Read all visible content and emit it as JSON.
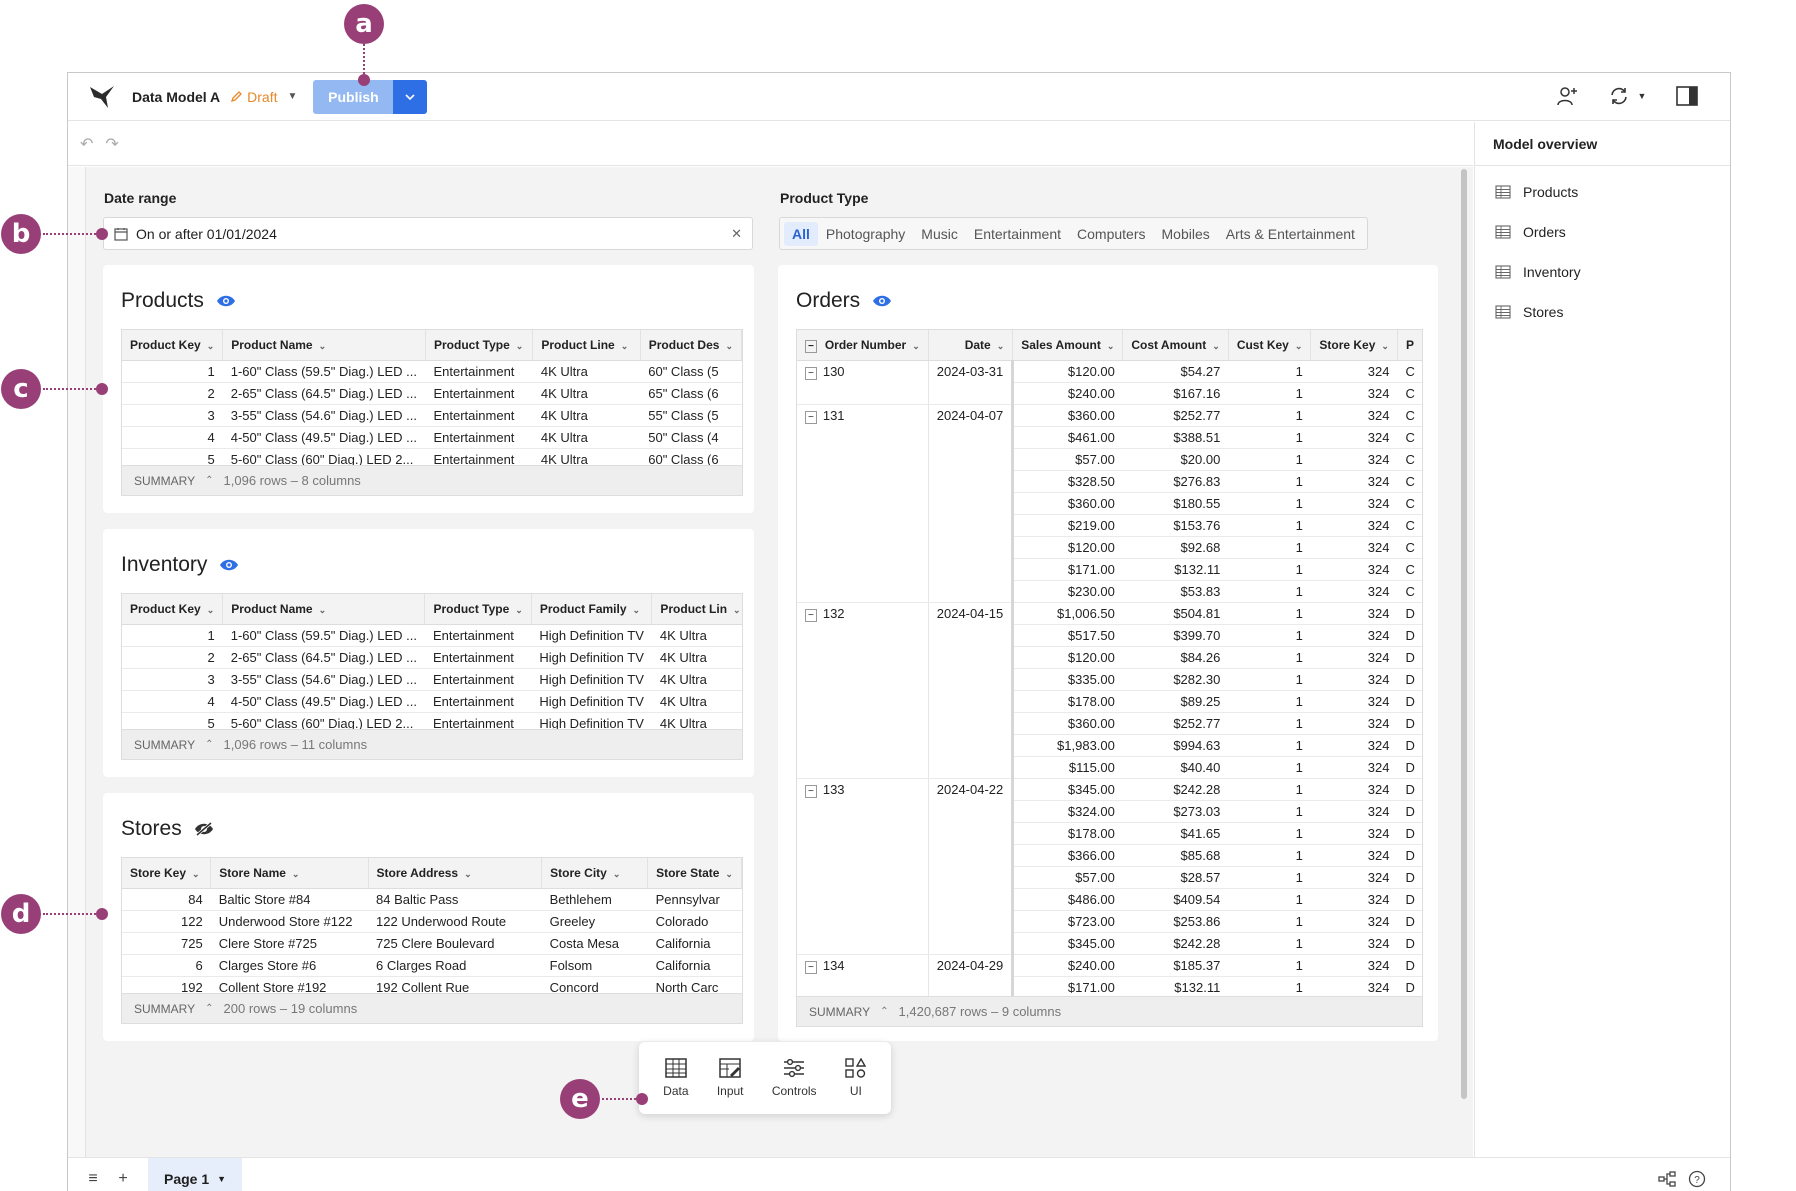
{
  "header": {
    "model_title": "Data Model A",
    "draft_label": "Draft",
    "publish_label": "Publish"
  },
  "filters": {
    "date_label": "Date range",
    "date_value": "On or after 01/01/2024",
    "ptype_label": "Product Type",
    "ptype_options": [
      "All",
      "Photography",
      "Music",
      "Entertainment",
      "Computers",
      "Mobiles",
      "Arts & Entertainment"
    ]
  },
  "products": {
    "title": "Products",
    "columns": [
      "Product Key",
      "Product Name",
      "Product Type",
      "Product Line",
      "Product Des"
    ],
    "rows": [
      [
        "1",
        "1-60\" Class (59.5\" Diag.)  LED  ...",
        "Entertainment",
        "4K Ultra",
        "60\" Class (5"
      ],
      [
        "2",
        "2-65\" Class (64.5\" Diag.)  LED  ...",
        "Entertainment",
        "4K Ultra",
        "65\" Class (6"
      ],
      [
        "3",
        "3-55\" Class (54.6\" Diag.)  LED  ...",
        "Entertainment",
        "4K Ultra",
        "55\" Class (5"
      ],
      [
        "4",
        "4-50\" Class (49.5\" Diag.)  LED  ...",
        "Entertainment",
        "4K Ultra",
        "50\" Class (4"
      ],
      [
        "5",
        "5-60\" Class (60\" Diag.)  LED  2...",
        "Entertainment",
        "4K Ultra",
        "60\" Class (6"
      ]
    ],
    "summary_label": "SUMMARY",
    "summary_text": "1,096 rows – 8 columns"
  },
  "inventory": {
    "title": "Inventory",
    "columns": [
      "Product Key",
      "Product Name",
      "Product Type",
      "Product Family",
      "Product Lin"
    ],
    "rows": [
      [
        "1",
        "1-60\" Class (59.5\" Diag.)  LED  ...",
        "Entertainment",
        "High Definition TV",
        "4K Ultra"
      ],
      [
        "2",
        "2-65\" Class (64.5\" Diag.)  LED  ...",
        "Entertainment",
        "High Definition TV",
        "4K Ultra"
      ],
      [
        "3",
        "3-55\" Class (54.6\" Diag.)  LED  ...",
        "Entertainment",
        "High Definition TV",
        "4K Ultra"
      ],
      [
        "4",
        "4-50\" Class (49.5\" Diag.)  LED  ...",
        "Entertainment",
        "High Definition TV",
        "4K Ultra"
      ],
      [
        "5",
        "5-60\" Class (60\" Diag.)  LED  2...",
        "Entertainment",
        "High Definition TV",
        "4K Ultra"
      ]
    ],
    "summary_label": "SUMMARY",
    "summary_text": "1,096 rows – 11 columns"
  },
  "stores": {
    "title": "Stores",
    "columns": [
      "Store Key",
      "Store Name",
      "Store Address",
      "Store City",
      "Store State"
    ],
    "rows": [
      [
        "84",
        "Baltic Store #84",
        "84 Baltic Pass",
        "Bethlehem",
        "Pennsylvar"
      ],
      [
        "122",
        "Underwood Store #122",
        "122 Underwood Route",
        "Greeley",
        "Colorado"
      ],
      [
        "725",
        "Clere Store #725",
        "725 Clere Boulevard",
        "Costa Mesa",
        "California"
      ],
      [
        "6",
        "Clarges Store #6",
        "6 Clarges Road",
        "Folsom",
        "California"
      ],
      [
        "192",
        "Collent Store #192",
        "192 Collent Rue",
        "Concord",
        "North Carc"
      ]
    ],
    "summary_label": "SUMMARY",
    "summary_text": "200 rows – 19 columns"
  },
  "orders": {
    "title": "Orders",
    "columns": [
      "Order Number",
      "Date",
      "Sales Amount",
      "Cost Amount",
      "Cust Key",
      "Store Key",
      "P"
    ],
    "groups": [
      {
        "order": "130",
        "date": "2024-03-31",
        "rows": [
          [
            "$120.00",
            "$54.27",
            "1",
            "324",
            "C"
          ],
          [
            "$240.00",
            "$167.16",
            "1",
            "324",
            "C"
          ]
        ]
      },
      {
        "order": "131",
        "date": "2024-04-07",
        "rows": [
          [
            "$360.00",
            "$252.77",
            "1",
            "324",
            "C"
          ],
          [
            "$461.00",
            "$388.51",
            "1",
            "324",
            "C"
          ],
          [
            "$57.00",
            "$20.00",
            "1",
            "324",
            "C"
          ],
          [
            "$328.50",
            "$276.83",
            "1",
            "324",
            "C"
          ],
          [
            "$360.00",
            "$180.55",
            "1",
            "324",
            "C"
          ],
          [
            "$219.00",
            "$153.76",
            "1",
            "324",
            "C"
          ],
          [
            "$120.00",
            "$92.68",
            "1",
            "324",
            "C"
          ],
          [
            "$171.00",
            "$132.11",
            "1",
            "324",
            "C"
          ],
          [
            "$230.00",
            "$53.83",
            "1",
            "324",
            "C"
          ]
        ]
      },
      {
        "order": "132",
        "date": "2024-04-15",
        "rows": [
          [
            "$1,006.50",
            "$504.81",
            "1",
            "324",
            "D"
          ],
          [
            "$517.50",
            "$399.70",
            "1",
            "324",
            "D"
          ],
          [
            "$120.00",
            "$84.26",
            "1",
            "324",
            "D"
          ],
          [
            "$335.00",
            "$282.30",
            "1",
            "324",
            "D"
          ],
          [
            "$178.00",
            "$89.25",
            "1",
            "324",
            "D"
          ],
          [
            "$360.00",
            "$252.77",
            "1",
            "324",
            "D"
          ],
          [
            "$1,983.00",
            "$994.63",
            "1",
            "324",
            "D"
          ],
          [
            "$115.00",
            "$40.40",
            "1",
            "324",
            "D"
          ]
        ]
      },
      {
        "order": "133",
        "date": "2024-04-22",
        "rows": [
          [
            "$345.00",
            "$242.28",
            "1",
            "324",
            "D"
          ],
          [
            "$324.00",
            "$273.03",
            "1",
            "324",
            "D"
          ],
          [
            "$178.00",
            "$41.65",
            "1",
            "324",
            "D"
          ],
          [
            "$366.00",
            "$85.68",
            "1",
            "324",
            "D"
          ],
          [
            "$57.00",
            "$28.57",
            "1",
            "324",
            "D"
          ],
          [
            "$486.00",
            "$409.54",
            "1",
            "324",
            "D"
          ],
          [
            "$723.00",
            "$253.86",
            "1",
            "324",
            "D"
          ],
          [
            "$345.00",
            "$242.28",
            "1",
            "324",
            "D"
          ]
        ]
      },
      {
        "order": "134",
        "date": "2024-04-29",
        "rows": [
          [
            "$240.00",
            "$185.37",
            "1",
            "324",
            "D"
          ],
          [
            "$171.00",
            "$132.11",
            "1",
            "324",
            "D"
          ]
        ]
      }
    ],
    "summary_label": "SUMMARY",
    "summary_text": "1,420,687 rows – 9 columns"
  },
  "toolbox": {
    "items": [
      {
        "label": "Data",
        "icon": "table-icon"
      },
      {
        "label": "Input",
        "icon": "input-table-icon"
      },
      {
        "label": "Controls",
        "icon": "sliders-icon"
      },
      {
        "label": "UI",
        "icon": "shapes-icon"
      }
    ]
  },
  "model_overview": {
    "title": "Model overview",
    "items": [
      "Products",
      "Orders",
      "Inventory",
      "Stores"
    ]
  },
  "bottom": {
    "page_tab": "Page 1"
  },
  "markers": {
    "a": "a",
    "b": "b",
    "c": "c",
    "d": "d",
    "e": "e"
  },
  "colors": {
    "accent": "#2e6fe6",
    "publish_disabled": "#94b9f2",
    "draft": "#e5892b",
    "marker": "#993f78"
  }
}
